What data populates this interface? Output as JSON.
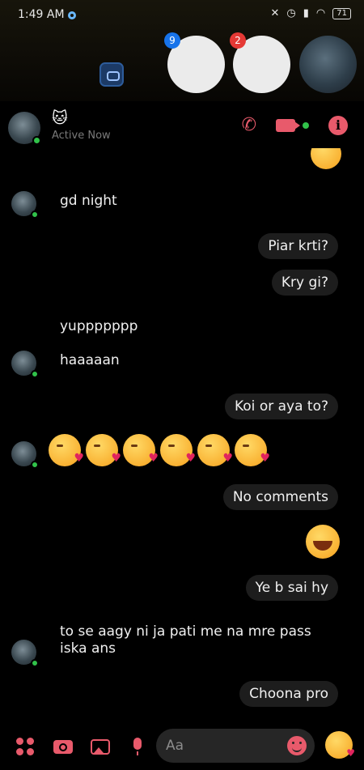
{
  "status_bar": {
    "time": "1:49 AM",
    "battery": "71"
  },
  "chat_heads": {
    "badge_1": "9",
    "badge_2": "2"
  },
  "header": {
    "name_emoji": "🐱",
    "status": "Active Now"
  },
  "messages": {
    "in_1": "gd night",
    "out_1": "Piar krti?",
    "out_2": "Kry gi?",
    "in_2": "yuppppppp",
    "in_3": "haaaaan",
    "out_3": "Koi or aya to?",
    "out_4": "No comments",
    "out_5": "Ye b sai hy",
    "in_4_line1": "to se aagy ni ja pati me na mre pass",
    "in_4_line2": "iska ans",
    "out_6": "Choona pro"
  },
  "composer": {
    "placeholder": "Aa"
  },
  "colors": {
    "accent": "#e85a6b",
    "online": "#31c24a",
    "bubble_out": "#1d1d1d"
  }
}
